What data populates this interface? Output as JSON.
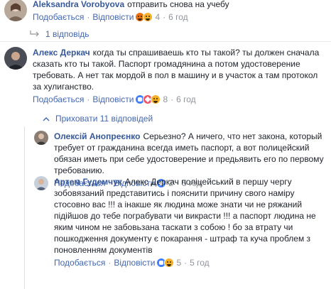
{
  "comments": [
    {
      "author": "Aleksandra Vorobyova",
      "text": "отправить снова на учебу",
      "like_label": "Подобається",
      "reply_label": "Відповісти",
      "reaction_count": "4",
      "time": "6 год"
    },
    {
      "author": "Алекс Деркач",
      "text": "когда ты спрашиваешь кто ты такой? ты должен сначала сказать кто ты такой. Паспорт громадянина а потом удостоверение требовать. А нет так мордой в пол в машину и в участок а там протокол за хулиганство.",
      "like_label": "Подобається",
      "reply_label": "Відповісти",
      "reaction_count": "8",
      "time": "6 год"
    },
    {
      "author": "Олексій Анопреєнко",
      "text": "Серьезно? А ничего, что нет закона, который требует от гражданина всегда иметь паспорт, а вот полицейский обязан иметь при себе удостоверение и предьявить его по первому требованию.",
      "like_label": "Подобається",
      "reply_label": "Відповісти",
      "reaction_count": "2",
      "time": "5 год"
    },
    {
      "author": "Артем Гудемчук",
      "text": "Алекс Деркач поліцейський в першу чергу зобовязаний представитись і пояснити причину свого наміру стосовно вас !!! а інакше як людина може знати чи не ряжаний підійшов до тебе пограбувати чи викрасти !!! а паспорт людина не яким чином не забовьзана таскати з собою ! бо за втрату чи пошкодження документу є покарання - штраф та куча проблем з поновленням документів",
      "like_label": "Подобається",
      "reply_label": "Відповісти",
      "reaction_count": "5",
      "time": "5 год"
    }
  ],
  "replies_link": "1 відповідь",
  "hide_replies": "Приховати 11 відповідей",
  "colors": {
    "link": "#4267b2",
    "author": "#365899",
    "meta": "#90949c",
    "text": "#1d2129"
  }
}
